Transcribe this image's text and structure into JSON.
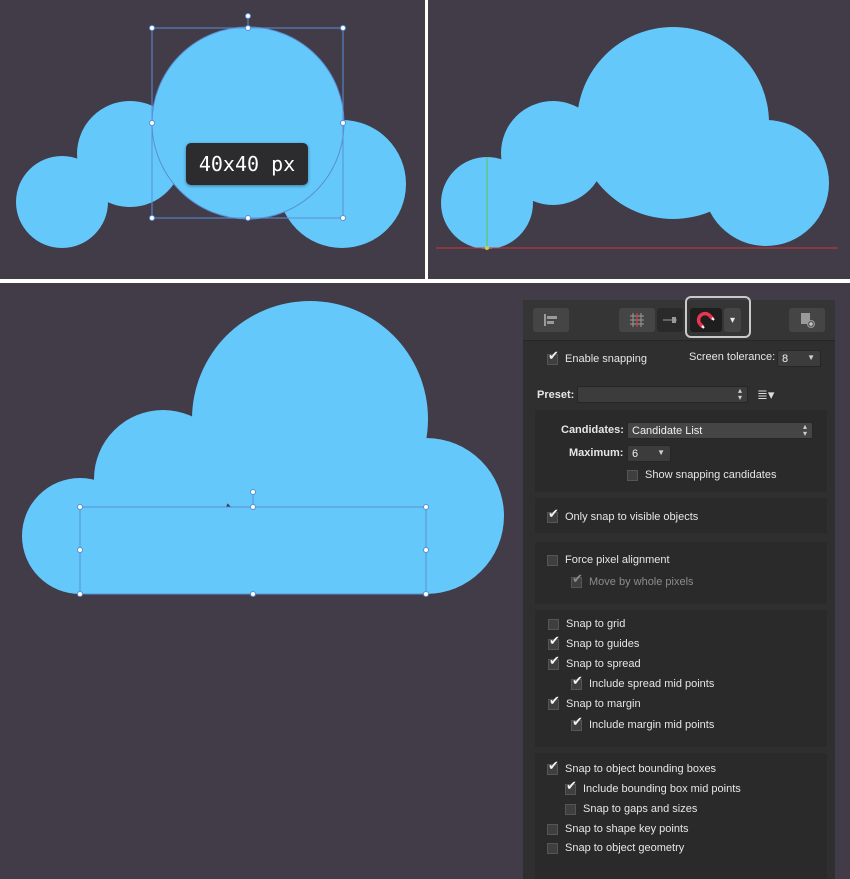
{
  "colors": {
    "canvas": "#423b48",
    "cloud": "#64c8fb",
    "handle": "#5a8fd6",
    "guide_green": "#59c64c",
    "guide_red": "#c93a3a",
    "panel": "#2f2f2f",
    "magnet": "#e8364f"
  },
  "canvas": {
    "tooltip": "40x40 px"
  },
  "toolbar": {
    "icons": [
      "align-icon",
      "grid-icon",
      "guides-icon",
      "magnet-icon",
      "dropdown-arrow-icon",
      "page-icon"
    ],
    "magnet_arrow": "▾"
  },
  "snapping": {
    "enable_snapping": {
      "label": "Enable snapping",
      "checked": true
    },
    "screen_tolerance_label": "Screen tolerance:",
    "screen_tolerance_value": "8",
    "preset_label": "Preset:",
    "preset_value": "",
    "candidates_label": "Candidates:",
    "candidates_value": "Candidate List",
    "maximum_label": "Maximum:",
    "maximum_value": "6",
    "show_candidates": {
      "label": "Show snapping candidates",
      "checked": false
    },
    "only_visible": {
      "label": "Only snap to visible objects",
      "checked": true
    },
    "force_pixel": {
      "label": "Force pixel alignment",
      "checked": false
    },
    "move_whole": {
      "label": "Move by whole pixels",
      "checked": true
    },
    "snap_grid": {
      "label": "Snap to grid",
      "checked": false
    },
    "snap_guides": {
      "label": "Snap to guides",
      "checked": true
    },
    "snap_spread": {
      "label": "Snap to spread",
      "checked": true
    },
    "spread_mid": {
      "label": "Include spread mid points",
      "checked": true
    },
    "snap_margin": {
      "label": "Snap to margin",
      "checked": true
    },
    "margin_mid": {
      "label": "Include margin mid points",
      "checked": true
    },
    "snap_bbox": {
      "label": "Snap to object bounding boxes",
      "checked": true
    },
    "bbox_mid": {
      "label": "Include bounding box mid points",
      "checked": true
    },
    "gaps_sizes": {
      "label": "Snap to gaps and sizes",
      "checked": false
    },
    "shape_key": {
      "label": "Snap to shape key points",
      "checked": false
    },
    "object_geometry": {
      "label": "Snap to object geometry",
      "checked": false
    }
  }
}
